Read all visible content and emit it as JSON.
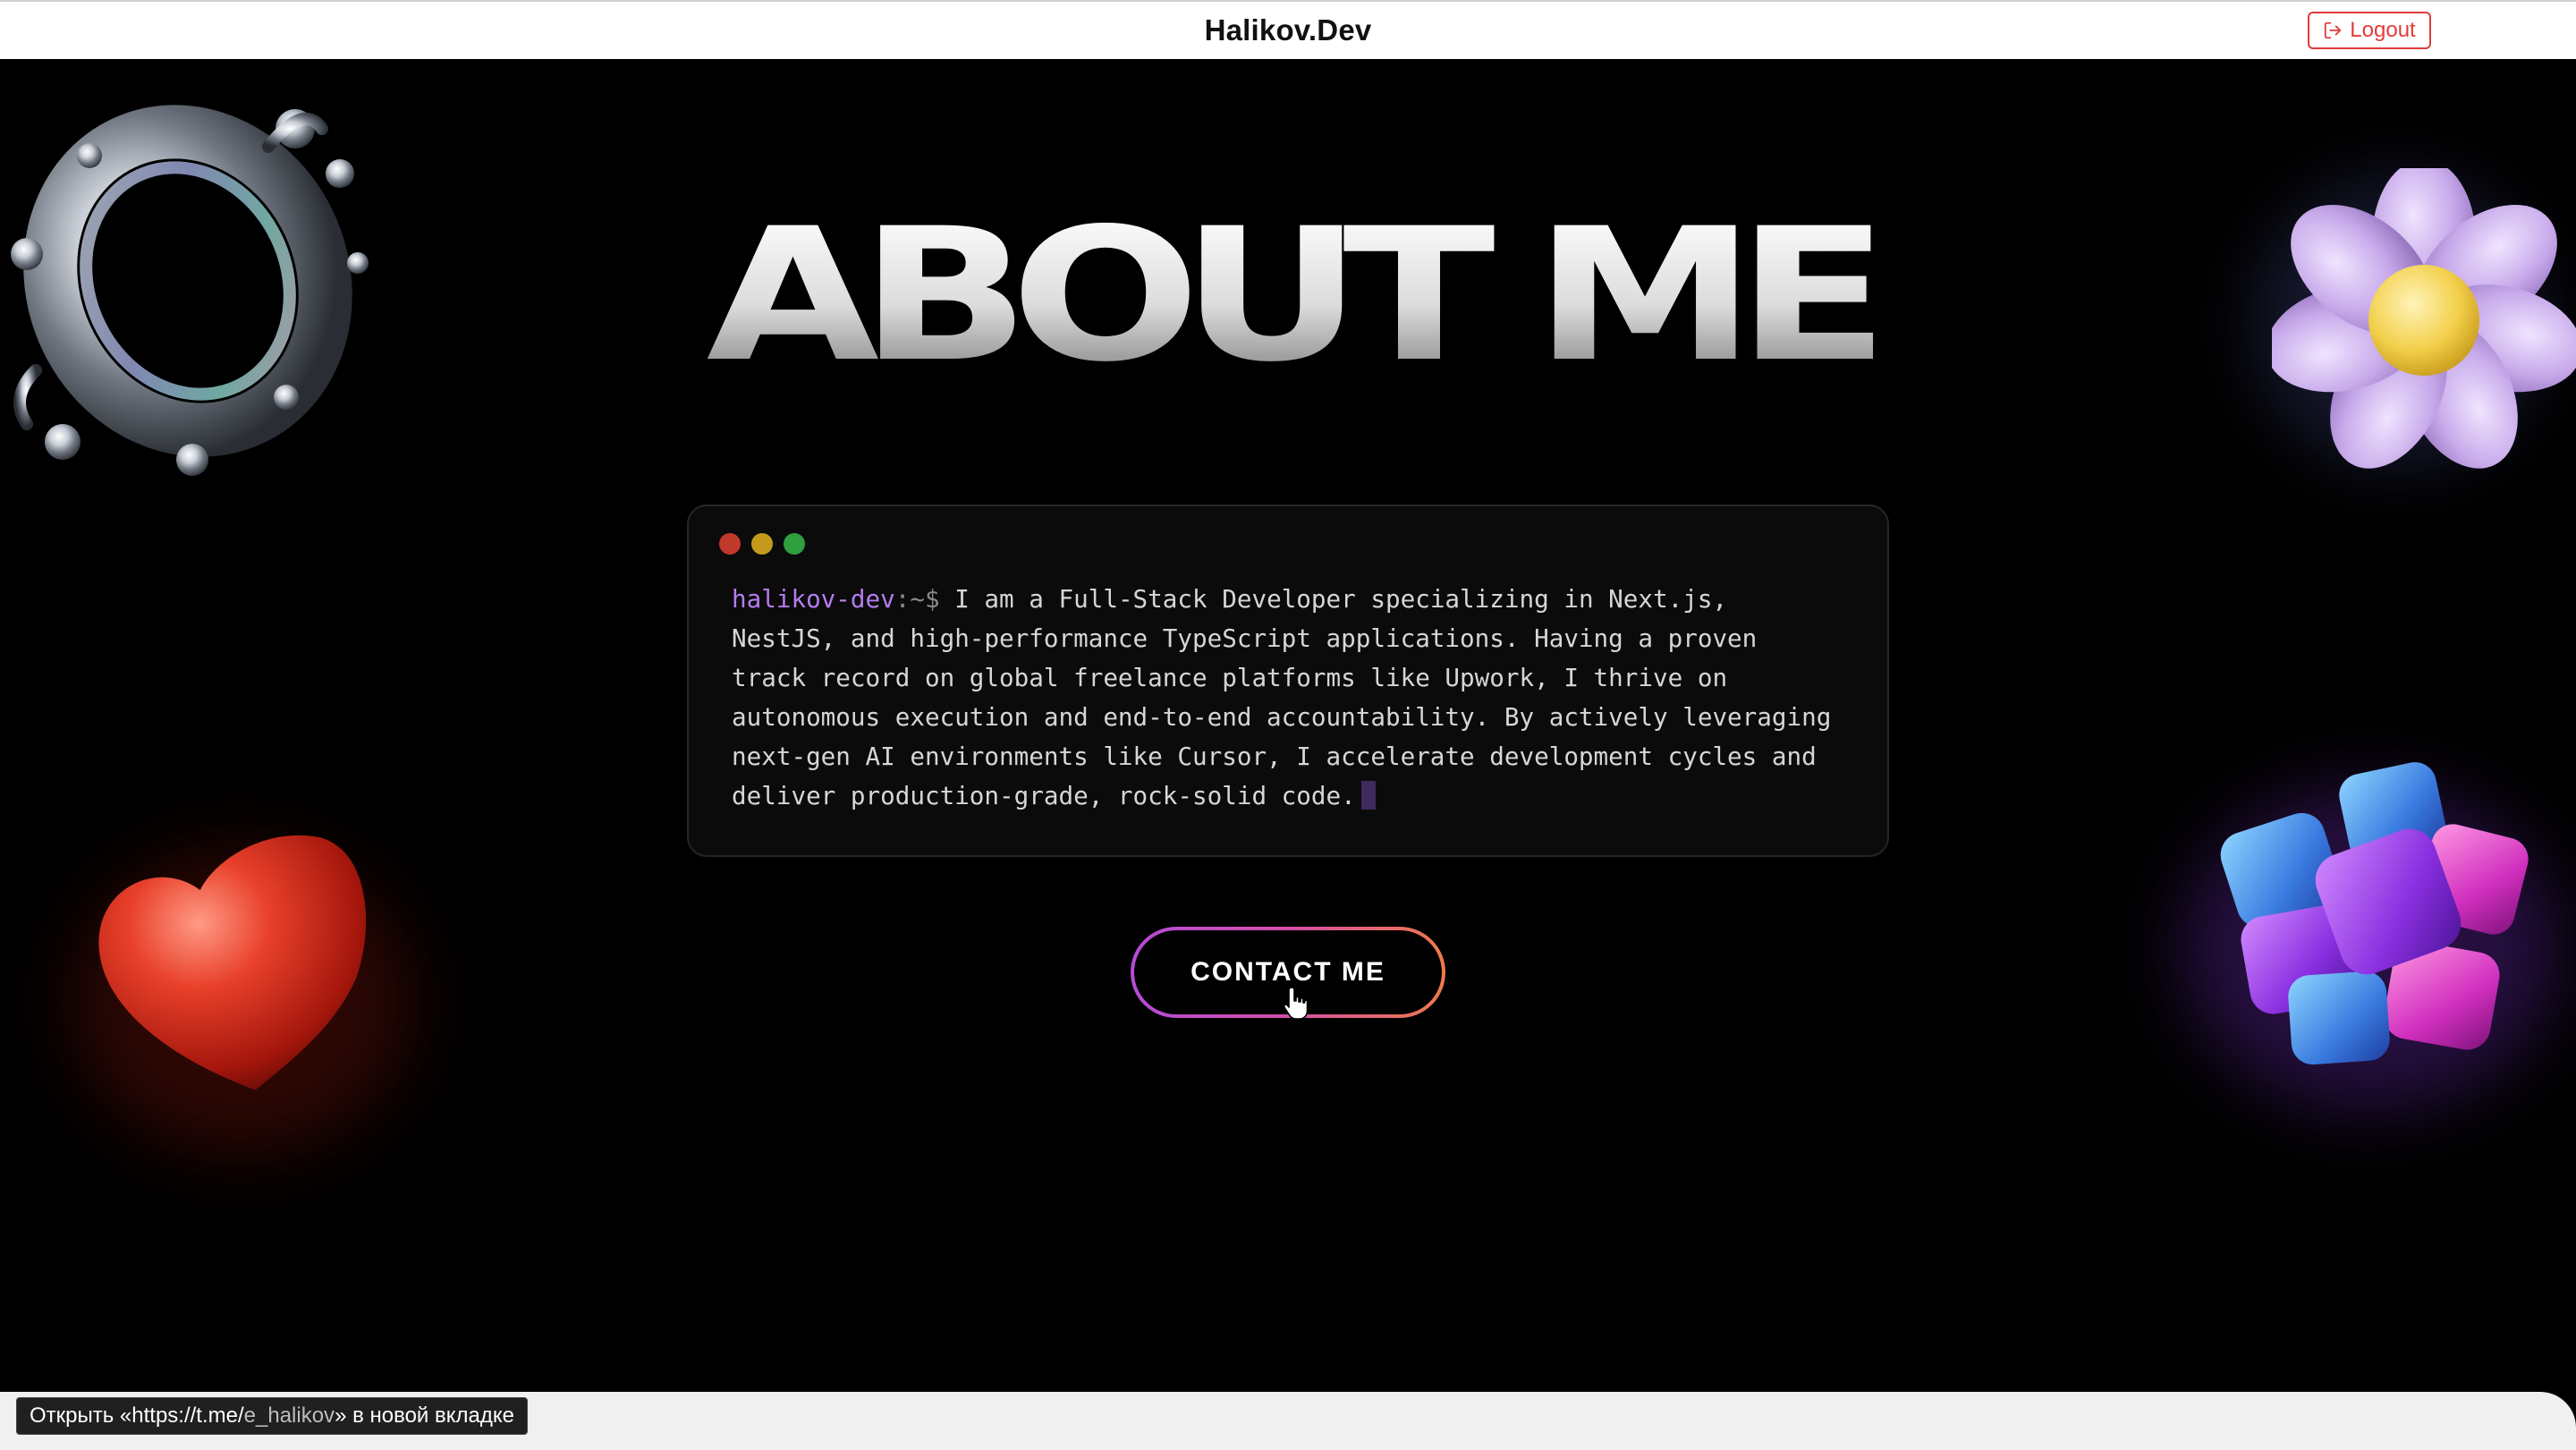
{
  "header": {
    "brand": "Halikov.Dev",
    "logout_label": "Logout"
  },
  "hero": {
    "title": "ABOUT ME"
  },
  "terminal": {
    "prompt_user": "halikov-dev",
    "prompt_sep": ":~$",
    "text": " I am a Full-Stack Developer specializing in Next.js,\nNestJS, and high-performance TypeScript applications. Having a proven\ntrack record on global freelance platforms like Upwork, I thrive on\nautonomous execution and end-to-end accountability. By actively leveraging\nnext-gen AI environments like Cursor, I accelerate development cycles and\ndeliver production-grade, rock-solid code.",
    "window_dots": [
      "#c0392b",
      "#c49a1c",
      "#2e9e3f"
    ]
  },
  "cta": {
    "label": "CONTACT ME"
  },
  "status_bar": {
    "prefix": "Открыть «https://t.me/",
    "handle": "e_halikov",
    "suffix": "» в новой вкладке"
  },
  "decorations": [
    "liquid-splash",
    "flower",
    "heart",
    "cube-cluster"
  ],
  "colors": {
    "accent_purple": "#b57cf0",
    "logout_red": "#e23b3b",
    "cta_gradient_start": "#b54bd6",
    "cta_gradient_end": "#ef7a48"
  }
}
